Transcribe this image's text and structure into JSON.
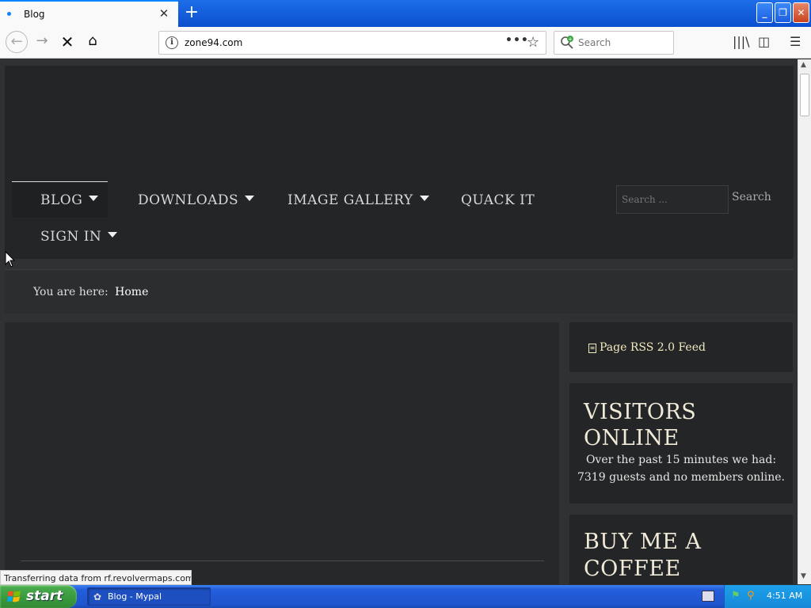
{
  "browser": {
    "tab_title": "Blog",
    "tab_close": "✕",
    "new_tab": "+",
    "url": "zone94.com",
    "search_placeholder": "Search",
    "page_actions": "•••",
    "bookmark_star": "☆"
  },
  "site": {
    "nav": [
      {
        "label": "BLOG"
      },
      {
        "label": "DOWNLOADS"
      },
      {
        "label": "IMAGE GALLERY"
      },
      {
        "label": "QUACK IT"
      },
      {
        "label": "SIGN IN"
      }
    ],
    "search_placeholder": "Search ...",
    "search_button": "Search",
    "breadcrumb_prefix": "You are here:",
    "breadcrumb_current": "Home",
    "rss_label": "Page RSS 2.0 Feed",
    "visitors_title_line1": "VISITORS",
    "visitors_title_line2": "ONLINE",
    "visitors_line1": "Over the past 15 minutes we had:",
    "visitors_line2": "7319 guests and no members online.",
    "coffee_title_line1": "BUY ME A",
    "coffee_title_line2": "COFFEE"
  },
  "status_text": "Transferring data from rf.revolvermaps.com...",
  "taskbar": {
    "start_label": "start",
    "task_label": "Blog - Mypal",
    "clock": "4:51 AM"
  }
}
